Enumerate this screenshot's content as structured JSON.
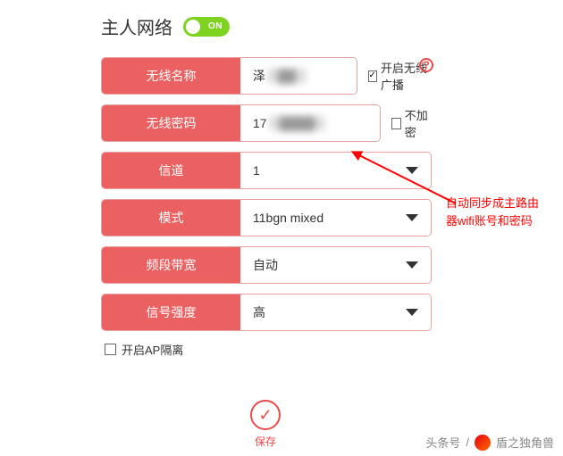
{
  "header": {
    "title": "主人网络",
    "toggle_label": "ON",
    "help_char": "?"
  },
  "fields": {
    "ssid": {
      "label": "无线名称",
      "value_prefix": "泽",
      "value_hidden": "██"
    },
    "password": {
      "label": "无线密码",
      "value_prefix": "17",
      "value_hidden": "████"
    },
    "channel": {
      "label": "信道",
      "value": "1"
    },
    "mode": {
      "label": "模式",
      "value": "11bgn mixed"
    },
    "bandwidth": {
      "label": "频段带宽",
      "value": "自动"
    },
    "signal": {
      "label": "信号强度",
      "value": "高"
    }
  },
  "checks": {
    "broadcast": {
      "label": "开启无线广播",
      "checked": true
    },
    "noencrypt": {
      "label": "不加密",
      "checked": false
    },
    "ap_isolation": {
      "label": "开启AP隔离",
      "checked": false
    }
  },
  "annotation": "自动同步成主路由器wifi账号和密码",
  "save_label": "保存",
  "attribution": {
    "prefix": "头条号",
    "sep": "/",
    "name": "盾之独角兽"
  }
}
